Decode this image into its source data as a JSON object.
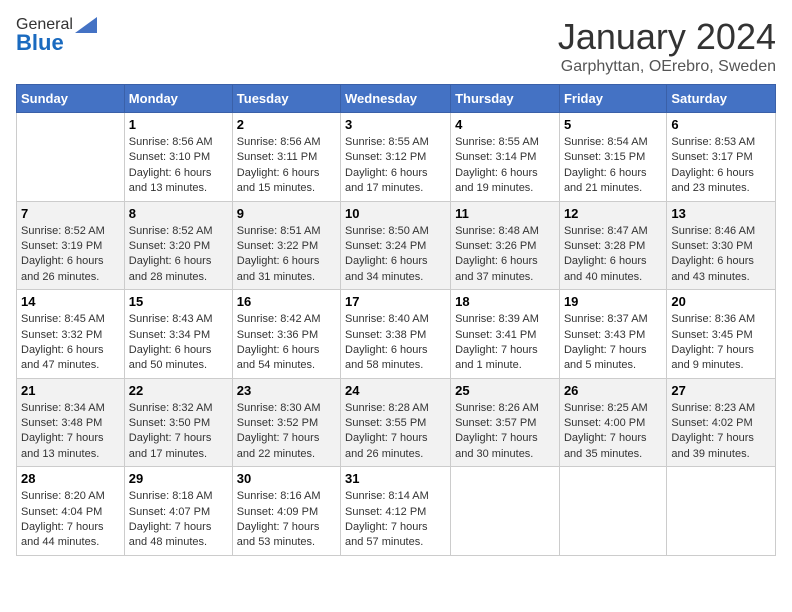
{
  "logo": {
    "general": "General",
    "blue": "Blue"
  },
  "title": "January 2024",
  "location": "Garphyttan, OErebro, Sweden",
  "days_header": [
    "Sunday",
    "Monday",
    "Tuesday",
    "Wednesday",
    "Thursday",
    "Friday",
    "Saturday"
  ],
  "weeks": [
    [
      {
        "day": "",
        "sunrise": "",
        "sunset": "",
        "daylight": ""
      },
      {
        "day": "1",
        "sunrise": "Sunrise: 8:56 AM",
        "sunset": "Sunset: 3:10 PM",
        "daylight": "Daylight: 6 hours and 13 minutes."
      },
      {
        "day": "2",
        "sunrise": "Sunrise: 8:56 AM",
        "sunset": "Sunset: 3:11 PM",
        "daylight": "Daylight: 6 hours and 15 minutes."
      },
      {
        "day": "3",
        "sunrise": "Sunrise: 8:55 AM",
        "sunset": "Sunset: 3:12 PM",
        "daylight": "Daylight: 6 hours and 17 minutes."
      },
      {
        "day": "4",
        "sunrise": "Sunrise: 8:55 AM",
        "sunset": "Sunset: 3:14 PM",
        "daylight": "Daylight: 6 hours and 19 minutes."
      },
      {
        "day": "5",
        "sunrise": "Sunrise: 8:54 AM",
        "sunset": "Sunset: 3:15 PM",
        "daylight": "Daylight: 6 hours and 21 minutes."
      },
      {
        "day": "6",
        "sunrise": "Sunrise: 8:53 AM",
        "sunset": "Sunset: 3:17 PM",
        "daylight": "Daylight: 6 hours and 23 minutes."
      }
    ],
    [
      {
        "day": "7",
        "sunrise": "Sunrise: 8:52 AM",
        "sunset": "Sunset: 3:19 PM",
        "daylight": "Daylight: 6 hours and 26 minutes."
      },
      {
        "day": "8",
        "sunrise": "Sunrise: 8:52 AM",
        "sunset": "Sunset: 3:20 PM",
        "daylight": "Daylight: 6 hours and 28 minutes."
      },
      {
        "day": "9",
        "sunrise": "Sunrise: 8:51 AM",
        "sunset": "Sunset: 3:22 PM",
        "daylight": "Daylight: 6 hours and 31 minutes."
      },
      {
        "day": "10",
        "sunrise": "Sunrise: 8:50 AM",
        "sunset": "Sunset: 3:24 PM",
        "daylight": "Daylight: 6 hours and 34 minutes."
      },
      {
        "day": "11",
        "sunrise": "Sunrise: 8:48 AM",
        "sunset": "Sunset: 3:26 PM",
        "daylight": "Daylight: 6 hours and 37 minutes."
      },
      {
        "day": "12",
        "sunrise": "Sunrise: 8:47 AM",
        "sunset": "Sunset: 3:28 PM",
        "daylight": "Daylight: 6 hours and 40 minutes."
      },
      {
        "day": "13",
        "sunrise": "Sunrise: 8:46 AM",
        "sunset": "Sunset: 3:30 PM",
        "daylight": "Daylight: 6 hours and 43 minutes."
      }
    ],
    [
      {
        "day": "14",
        "sunrise": "Sunrise: 8:45 AM",
        "sunset": "Sunset: 3:32 PM",
        "daylight": "Daylight: 6 hours and 47 minutes."
      },
      {
        "day": "15",
        "sunrise": "Sunrise: 8:43 AM",
        "sunset": "Sunset: 3:34 PM",
        "daylight": "Daylight: 6 hours and 50 minutes."
      },
      {
        "day": "16",
        "sunrise": "Sunrise: 8:42 AM",
        "sunset": "Sunset: 3:36 PM",
        "daylight": "Daylight: 6 hours and 54 minutes."
      },
      {
        "day": "17",
        "sunrise": "Sunrise: 8:40 AM",
        "sunset": "Sunset: 3:38 PM",
        "daylight": "Daylight: 6 hours and 58 minutes."
      },
      {
        "day": "18",
        "sunrise": "Sunrise: 8:39 AM",
        "sunset": "Sunset: 3:41 PM",
        "daylight": "Daylight: 7 hours and 1 minute."
      },
      {
        "day": "19",
        "sunrise": "Sunrise: 8:37 AM",
        "sunset": "Sunset: 3:43 PM",
        "daylight": "Daylight: 7 hours and 5 minutes."
      },
      {
        "day": "20",
        "sunrise": "Sunrise: 8:36 AM",
        "sunset": "Sunset: 3:45 PM",
        "daylight": "Daylight: 7 hours and 9 minutes."
      }
    ],
    [
      {
        "day": "21",
        "sunrise": "Sunrise: 8:34 AM",
        "sunset": "Sunset: 3:48 PM",
        "daylight": "Daylight: 7 hours and 13 minutes."
      },
      {
        "day": "22",
        "sunrise": "Sunrise: 8:32 AM",
        "sunset": "Sunset: 3:50 PM",
        "daylight": "Daylight: 7 hours and 17 minutes."
      },
      {
        "day": "23",
        "sunrise": "Sunrise: 8:30 AM",
        "sunset": "Sunset: 3:52 PM",
        "daylight": "Daylight: 7 hours and 22 minutes."
      },
      {
        "day": "24",
        "sunrise": "Sunrise: 8:28 AM",
        "sunset": "Sunset: 3:55 PM",
        "daylight": "Daylight: 7 hours and 26 minutes."
      },
      {
        "day": "25",
        "sunrise": "Sunrise: 8:26 AM",
        "sunset": "Sunset: 3:57 PM",
        "daylight": "Daylight: 7 hours and 30 minutes."
      },
      {
        "day": "26",
        "sunrise": "Sunrise: 8:25 AM",
        "sunset": "Sunset: 4:00 PM",
        "daylight": "Daylight: 7 hours and 35 minutes."
      },
      {
        "day": "27",
        "sunrise": "Sunrise: 8:23 AM",
        "sunset": "Sunset: 4:02 PM",
        "daylight": "Daylight: 7 hours and 39 minutes."
      }
    ],
    [
      {
        "day": "28",
        "sunrise": "Sunrise: 8:20 AM",
        "sunset": "Sunset: 4:04 PM",
        "daylight": "Daylight: 7 hours and 44 minutes."
      },
      {
        "day": "29",
        "sunrise": "Sunrise: 8:18 AM",
        "sunset": "Sunset: 4:07 PM",
        "daylight": "Daylight: 7 hours and 48 minutes."
      },
      {
        "day": "30",
        "sunrise": "Sunrise: 8:16 AM",
        "sunset": "Sunset: 4:09 PM",
        "daylight": "Daylight: 7 hours and 53 minutes."
      },
      {
        "day": "31",
        "sunrise": "Sunrise: 8:14 AM",
        "sunset": "Sunset: 4:12 PM",
        "daylight": "Daylight: 7 hours and 57 minutes."
      },
      {
        "day": "",
        "sunrise": "",
        "sunset": "",
        "daylight": ""
      },
      {
        "day": "",
        "sunrise": "",
        "sunset": "",
        "daylight": ""
      },
      {
        "day": "",
        "sunrise": "",
        "sunset": "",
        "daylight": ""
      }
    ]
  ]
}
